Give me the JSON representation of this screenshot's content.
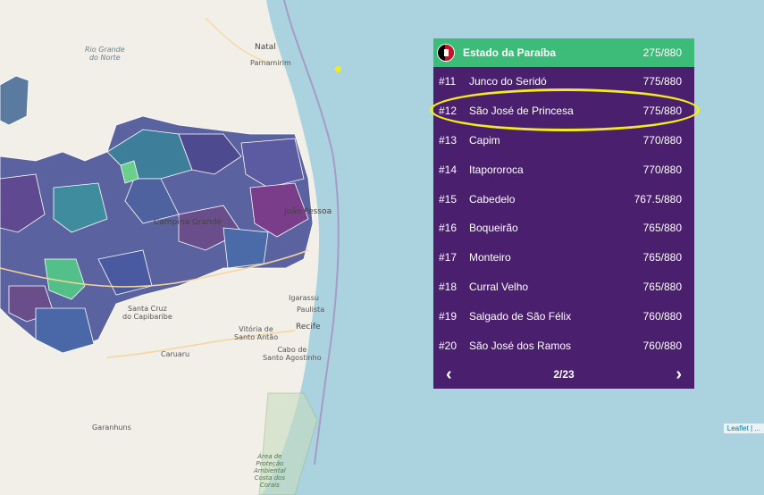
{
  "map": {
    "labels": {
      "natal": "Natal",
      "parnamirim": "Parnamirim",
      "rio_grande": "Rio Grande\ndo Norte",
      "campina": "Campina Grande",
      "joao": "João Pessoa",
      "igarassu": "Igarassu",
      "paulista": "Paulista",
      "santa_cruz": "Santa Cruz\ndo Capibaribe",
      "recife": "Recife",
      "vitoria": "Vitória de\nSanto Antão",
      "caruaru": "Caruaru",
      "cabo": "Cabo de\nSanto Agostinho",
      "garanhuns": "Garanhuns",
      "apa": "Área de\nProteção\nAmbiental\nCosta dos\nCorais"
    },
    "attribution": "Leaflet | ..."
  },
  "panel": {
    "header": {
      "name": "Estado da Paraíba",
      "score": "275/880",
      "flag_icon": "paraiba-flag-icon"
    },
    "rows": [
      {
        "rank": "#11",
        "name": "Junco do Seridó",
        "score": "775/880"
      },
      {
        "rank": "#12",
        "name": "São José de Princesa",
        "score": "775/880"
      },
      {
        "rank": "#13",
        "name": "Capim",
        "score": "770/880"
      },
      {
        "rank": "#14",
        "name": "Itapororoca",
        "score": "770/880"
      },
      {
        "rank": "#15",
        "name": "Cabedelo",
        "score": "767.5/880"
      },
      {
        "rank": "#16",
        "name": "Boqueirão",
        "score": "765/880"
      },
      {
        "rank": "#17",
        "name": "Monteiro",
        "score": "765/880"
      },
      {
        "rank": "#18",
        "name": "Curral Velho",
        "score": "765/880"
      },
      {
        "rank": "#19",
        "name": "Salgado de São Félix",
        "score": "760/880"
      },
      {
        "rank": "#20",
        "name": "São José dos Ramos",
        "score": "760/880"
      }
    ],
    "pager": {
      "page": "2/23",
      "prev": "‹",
      "next": "›"
    },
    "colors": {
      "header": "#3dbb78",
      "body": "#4a1f6e",
      "highlight": "#f3ec19"
    }
  }
}
